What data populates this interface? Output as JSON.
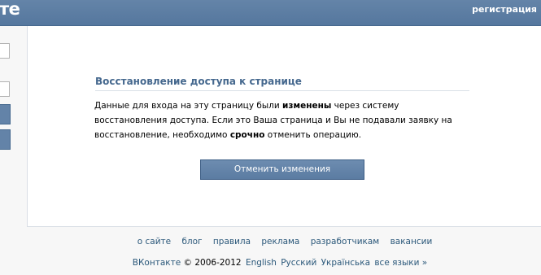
{
  "header": {
    "logo_text": "те",
    "register_link": "регистрация"
  },
  "recovery": {
    "title": "Восстановление доступа к странице",
    "message": {
      "part1": "Данные для входа на эту страницу были ",
      "bold1": "изменены",
      "part2": " через систему восстановления доступа. Если это Ваша страница и Вы не подавали заявку на восстановление, необходимо ",
      "bold2": "срочно",
      "part3": " отменить операцию."
    },
    "cancel_button": "Отменить изменения"
  },
  "footer": {
    "links": [
      "о сайте",
      "блог",
      "правила",
      "реклама",
      "разработчикам",
      "вакансии"
    ],
    "brand": "ВКонтакте",
    "copyright": "© 2006-2012",
    "languages": [
      "English",
      "Русский",
      "Українська",
      "все языки »"
    ]
  },
  "colors": {
    "header_bg": "#5b7ca2",
    "accent_text": "#45688e",
    "link": "#2b587a"
  }
}
